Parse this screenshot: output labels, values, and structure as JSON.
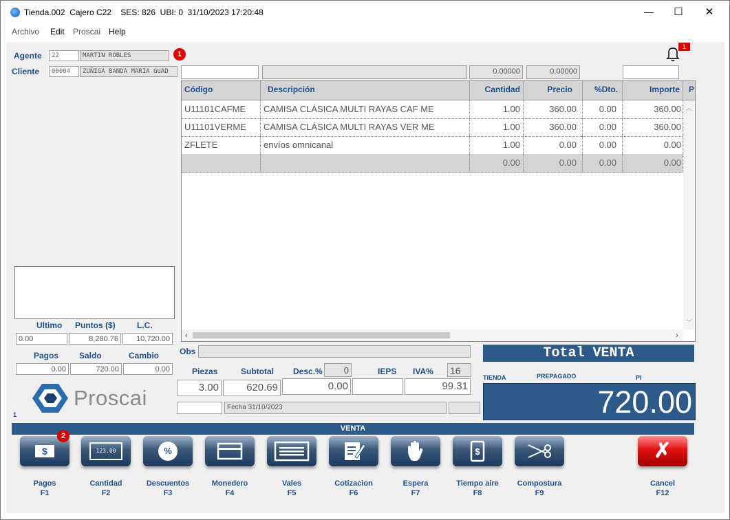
{
  "window": {
    "title": "Tienda.002  Cajero C22    SES: 826  UBI: 0  31/10/2023 17:20:48",
    "minimize": "—",
    "maximize": "☐",
    "close": "✕"
  },
  "menu": [
    "Archivo",
    "Edit",
    "Proscai",
    "Help"
  ],
  "agent": {
    "label": "Agente",
    "code": "22",
    "name": "MARTIN ROBLES"
  },
  "client": {
    "label": "Cliente",
    "code": "00004",
    "name": "ZUÑIGA BANDA MARIA GUAD"
  },
  "badges": {
    "one": "1",
    "two": "2",
    "notif": "1"
  },
  "entry": {
    "qty": "0.00000",
    "price": "0.00000"
  },
  "grid": {
    "headers": [
      "Código",
      "Descripción",
      "Cantidad",
      "Precio",
      "%Dto.",
      "Importe",
      "P"
    ],
    "rows": [
      [
        "U11101CAFME",
        "CAMISA CLÁSICA MULTI RAYAS CAF ME",
        "1.00",
        "360.00",
        "0.00",
        "360.00"
      ],
      [
        "U11101VERME",
        "CAMISA CLÁSICA MULTI RAYAS VER ME",
        "1.00",
        "360.00",
        "0.00",
        "360.00"
      ],
      [
        "ZFLETE",
        "envíos omnicanal",
        "1.00",
        "0.00",
        "0.00",
        "0.00"
      ],
      [
        "",
        "",
        "0.00",
        "0.00",
        "0.00",
        "0.00"
      ]
    ]
  },
  "left_stats": {
    "labels1": [
      "Ultimo",
      "Puntos ($)",
      "L.C."
    ],
    "values1": [
      "0.00",
      "8,280.76",
      "10,720.00"
    ],
    "labels2": [
      "Pagos",
      "Saldo",
      "Cambio"
    ],
    "values2": [
      "0.00",
      "720.00",
      "0.00"
    ]
  },
  "logo": {
    "text": "Proscai",
    "small": "1"
  },
  "obs_label": "Obs",
  "totals": {
    "labels": [
      "Piezas",
      "Subtotal",
      "Desc.%",
      "IEPS",
      "IVA%"
    ],
    "desc_pct": "0",
    "iva_pct": "16",
    "piezas": "3.00",
    "subtotal": "620.69",
    "desc": "0.00",
    "ieps": "",
    "iva": "99.31",
    "fecha": "Fecha 31/10/2023"
  },
  "total_venta": {
    "title": "Total VENTA",
    "tienda": "TIENDA",
    "prepagado": "PREPAGADO",
    "pi": "PI",
    "amount": "720.00"
  },
  "venta_bar": "VENTA",
  "buttons": [
    {
      "label": "Pagos",
      "key": "F1"
    },
    {
      "label": "Cantidad",
      "key": "F2"
    },
    {
      "label": "Descuentos",
      "key": "F3"
    },
    {
      "label": "Monedero",
      "key": "F4"
    },
    {
      "label": "Vales",
      "key": "F5"
    },
    {
      "label": "Cotizacion",
      "key": "F6"
    },
    {
      "label": "Espera",
      "key": "F7"
    },
    {
      "label": "Tiempo aire",
      "key": "F8"
    },
    {
      "label": "Compostura",
      "key": "F9"
    },
    {
      "label": "Cancel",
      "key": "F12"
    }
  ],
  "button_glyphs": {
    "pagos": "$",
    "cantidad": "123.00",
    "descuentos": "%",
    "cancel": "✗"
  },
  "colors": {
    "accent": "#1f4e8c",
    "panel": "#2e5a8a",
    "cancel": "#e01010"
  }
}
